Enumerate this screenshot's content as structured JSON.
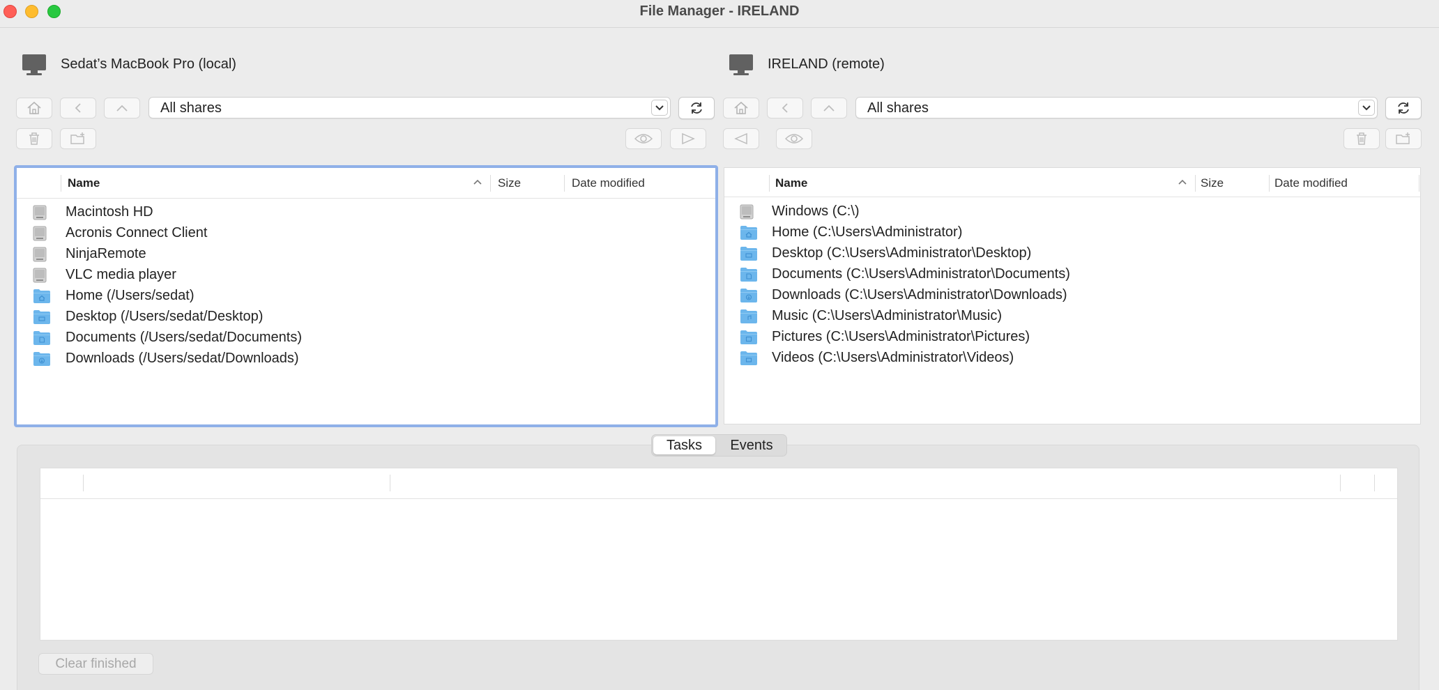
{
  "window": {
    "title": "File Manager - IRELAND"
  },
  "local": {
    "machine_label": "Sedat’s MacBook Pro (local)",
    "share_select": "All shares",
    "columns": {
      "name": "Name",
      "size": "Size",
      "date": "Date modified"
    },
    "items": [
      {
        "label": "Macintosh HD",
        "icon": "drive-icon"
      },
      {
        "label": "Acronis Connect Client",
        "icon": "drive-icon"
      },
      {
        "label": "NinjaRemote",
        "icon": "drive-icon"
      },
      {
        "label": "VLC media player",
        "icon": "drive-icon"
      },
      {
        "label": "Home (/Users/sedat)",
        "icon": "home-folder-icon"
      },
      {
        "label": "Desktop (/Users/sedat/Desktop)",
        "icon": "desktop-folder-icon"
      },
      {
        "label": "Documents (/Users/sedat/Documents)",
        "icon": "documents-folder-icon"
      },
      {
        "label": "Downloads (/Users/sedat/Downloads)",
        "icon": "downloads-folder-icon"
      }
    ]
  },
  "remote": {
    "machine_label": "IRELAND (remote)",
    "share_select": "All shares",
    "columns": {
      "name": "Name",
      "size": "Size",
      "date": "Date modified"
    },
    "items": [
      {
        "label": "Windows (C:\\)",
        "icon": "drive-icon"
      },
      {
        "label": "Home (C:\\Users\\Administrator)",
        "icon": "home-folder-icon"
      },
      {
        "label": "Desktop (C:\\Users\\Administrator\\Desktop)",
        "icon": "desktop-folder-icon"
      },
      {
        "label": "Documents (C:\\Users\\Administrator\\Documents)",
        "icon": "documents-folder-icon"
      },
      {
        "label": "Downloads (C:\\Users\\Administrator\\Downloads)",
        "icon": "downloads-folder-icon"
      },
      {
        "label": "Music (C:\\Users\\Administrator\\Music)",
        "icon": "music-folder-icon"
      },
      {
        "label": "Pictures (C:\\Users\\Administrator\\Pictures)",
        "icon": "pictures-folder-icon"
      },
      {
        "label": "Videos (C:\\Users\\Administrator\\Videos)",
        "icon": "videos-folder-icon"
      }
    ]
  },
  "bottom": {
    "tabs": [
      "Tasks",
      "Events"
    ],
    "selected_tab": "Tasks",
    "clear_label": "Clear finished"
  },
  "colors": {
    "focus_ring": "#8fb0e8",
    "folder": "#6cb6ec",
    "close": "#ff5f57",
    "minimize": "#febc2e",
    "maximize": "#28c840"
  }
}
